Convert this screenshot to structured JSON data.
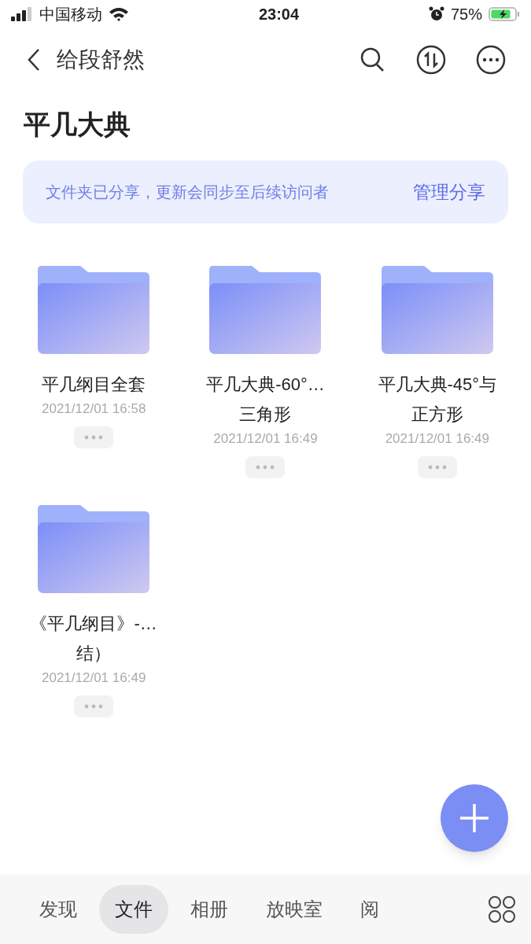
{
  "status_bar": {
    "carrier": "中国移动",
    "time": "23:04",
    "battery": "75%"
  },
  "nav": {
    "title": "给段舒然"
  },
  "heading": "平几大典",
  "share_banner": {
    "message": "文件夹已分享，更新会同步至后续访问者",
    "action": "管理分享"
  },
  "folders": [
    {
      "name": "平几纲目全套",
      "date": "2021/12/01 16:58"
    },
    {
      "name": "平几大典-60°…三角形",
      "date": "2021/12/01 16:49"
    },
    {
      "name": "平几大典-45°与正方形",
      "date": "2021/12/01 16:49"
    },
    {
      "name": "《平几纲目》-…结）",
      "date": "2021/12/01 16:49"
    }
  ],
  "tabs": [
    {
      "label": "发现",
      "selected": false
    },
    {
      "label": "文件",
      "selected": true
    },
    {
      "label": "相册",
      "selected": false
    },
    {
      "label": "放映室",
      "selected": false
    },
    {
      "label": "阅",
      "selected": false
    }
  ]
}
